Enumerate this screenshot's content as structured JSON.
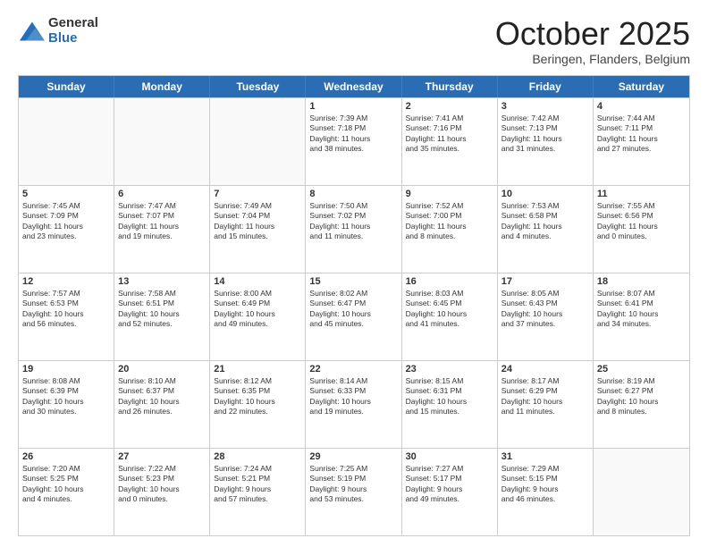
{
  "logo": {
    "general": "General",
    "blue": "Blue"
  },
  "header": {
    "month": "October 2025",
    "location": "Beringen, Flanders, Belgium"
  },
  "days": [
    "Sunday",
    "Monday",
    "Tuesday",
    "Wednesday",
    "Thursday",
    "Friday",
    "Saturday"
  ],
  "weeks": [
    [
      {
        "day": "",
        "content": ""
      },
      {
        "day": "",
        "content": ""
      },
      {
        "day": "",
        "content": ""
      },
      {
        "day": "1",
        "content": "Sunrise: 7:39 AM\nSunset: 7:18 PM\nDaylight: 11 hours\nand 38 minutes."
      },
      {
        "day": "2",
        "content": "Sunrise: 7:41 AM\nSunset: 7:16 PM\nDaylight: 11 hours\nand 35 minutes."
      },
      {
        "day": "3",
        "content": "Sunrise: 7:42 AM\nSunset: 7:13 PM\nDaylight: 11 hours\nand 31 minutes."
      },
      {
        "day": "4",
        "content": "Sunrise: 7:44 AM\nSunset: 7:11 PM\nDaylight: 11 hours\nand 27 minutes."
      }
    ],
    [
      {
        "day": "5",
        "content": "Sunrise: 7:45 AM\nSunset: 7:09 PM\nDaylight: 11 hours\nand 23 minutes."
      },
      {
        "day": "6",
        "content": "Sunrise: 7:47 AM\nSunset: 7:07 PM\nDaylight: 11 hours\nand 19 minutes."
      },
      {
        "day": "7",
        "content": "Sunrise: 7:49 AM\nSunset: 7:04 PM\nDaylight: 11 hours\nand 15 minutes."
      },
      {
        "day": "8",
        "content": "Sunrise: 7:50 AM\nSunset: 7:02 PM\nDaylight: 11 hours\nand 11 minutes."
      },
      {
        "day": "9",
        "content": "Sunrise: 7:52 AM\nSunset: 7:00 PM\nDaylight: 11 hours\nand 8 minutes."
      },
      {
        "day": "10",
        "content": "Sunrise: 7:53 AM\nSunset: 6:58 PM\nDaylight: 11 hours\nand 4 minutes."
      },
      {
        "day": "11",
        "content": "Sunrise: 7:55 AM\nSunset: 6:56 PM\nDaylight: 11 hours\nand 0 minutes."
      }
    ],
    [
      {
        "day": "12",
        "content": "Sunrise: 7:57 AM\nSunset: 6:53 PM\nDaylight: 10 hours\nand 56 minutes."
      },
      {
        "day": "13",
        "content": "Sunrise: 7:58 AM\nSunset: 6:51 PM\nDaylight: 10 hours\nand 52 minutes."
      },
      {
        "day": "14",
        "content": "Sunrise: 8:00 AM\nSunset: 6:49 PM\nDaylight: 10 hours\nand 49 minutes."
      },
      {
        "day": "15",
        "content": "Sunrise: 8:02 AM\nSunset: 6:47 PM\nDaylight: 10 hours\nand 45 minutes."
      },
      {
        "day": "16",
        "content": "Sunrise: 8:03 AM\nSunset: 6:45 PM\nDaylight: 10 hours\nand 41 minutes."
      },
      {
        "day": "17",
        "content": "Sunrise: 8:05 AM\nSunset: 6:43 PM\nDaylight: 10 hours\nand 37 minutes."
      },
      {
        "day": "18",
        "content": "Sunrise: 8:07 AM\nSunset: 6:41 PM\nDaylight: 10 hours\nand 34 minutes."
      }
    ],
    [
      {
        "day": "19",
        "content": "Sunrise: 8:08 AM\nSunset: 6:39 PM\nDaylight: 10 hours\nand 30 minutes."
      },
      {
        "day": "20",
        "content": "Sunrise: 8:10 AM\nSunset: 6:37 PM\nDaylight: 10 hours\nand 26 minutes."
      },
      {
        "day": "21",
        "content": "Sunrise: 8:12 AM\nSunset: 6:35 PM\nDaylight: 10 hours\nand 22 minutes."
      },
      {
        "day": "22",
        "content": "Sunrise: 8:14 AM\nSunset: 6:33 PM\nDaylight: 10 hours\nand 19 minutes."
      },
      {
        "day": "23",
        "content": "Sunrise: 8:15 AM\nSunset: 6:31 PM\nDaylight: 10 hours\nand 15 minutes."
      },
      {
        "day": "24",
        "content": "Sunrise: 8:17 AM\nSunset: 6:29 PM\nDaylight: 10 hours\nand 11 minutes."
      },
      {
        "day": "25",
        "content": "Sunrise: 8:19 AM\nSunset: 6:27 PM\nDaylight: 10 hours\nand 8 minutes."
      }
    ],
    [
      {
        "day": "26",
        "content": "Sunrise: 7:20 AM\nSunset: 5:25 PM\nDaylight: 10 hours\nand 4 minutes."
      },
      {
        "day": "27",
        "content": "Sunrise: 7:22 AM\nSunset: 5:23 PM\nDaylight: 10 hours\nand 0 minutes."
      },
      {
        "day": "28",
        "content": "Sunrise: 7:24 AM\nSunset: 5:21 PM\nDaylight: 9 hours\nand 57 minutes."
      },
      {
        "day": "29",
        "content": "Sunrise: 7:25 AM\nSunset: 5:19 PM\nDaylight: 9 hours\nand 53 minutes."
      },
      {
        "day": "30",
        "content": "Sunrise: 7:27 AM\nSunset: 5:17 PM\nDaylight: 9 hours\nand 49 minutes."
      },
      {
        "day": "31",
        "content": "Sunrise: 7:29 AM\nSunset: 5:15 PM\nDaylight: 9 hours\nand 46 minutes."
      },
      {
        "day": "",
        "content": ""
      }
    ]
  ]
}
